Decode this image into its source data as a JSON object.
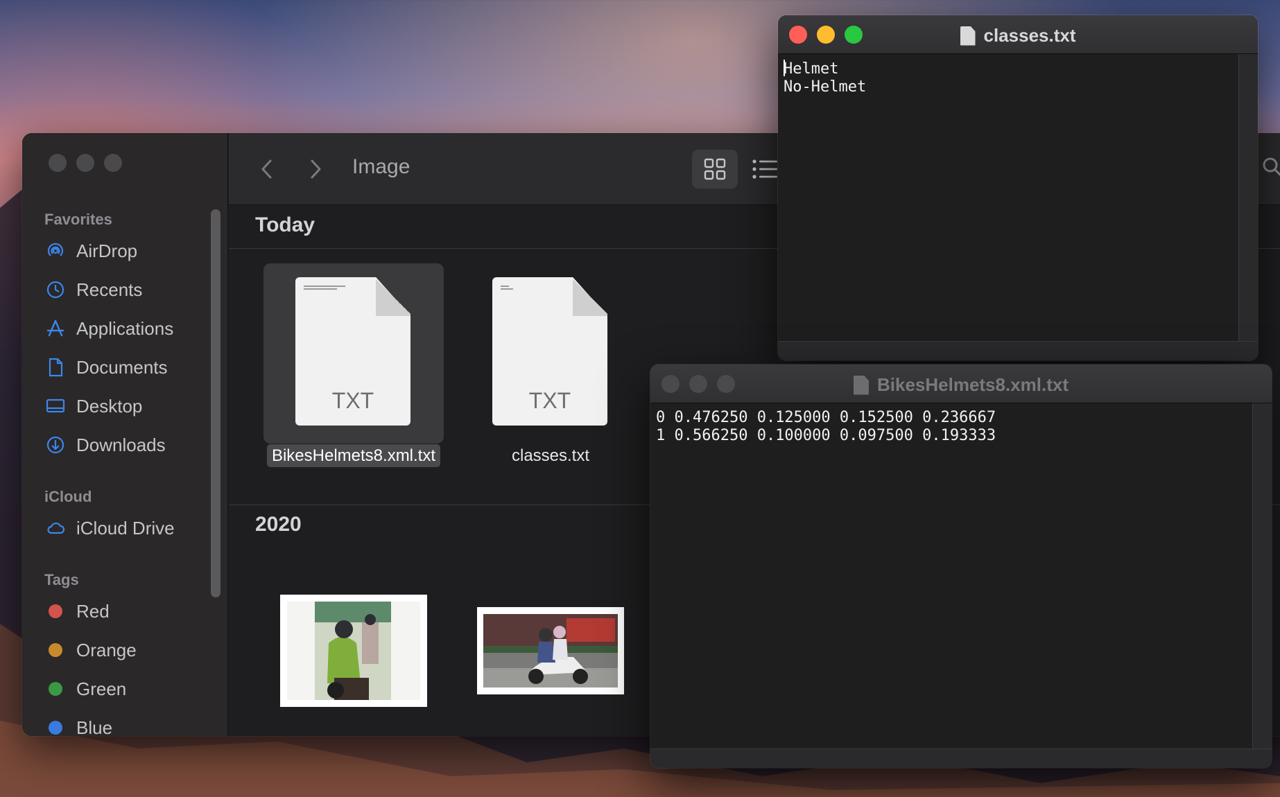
{
  "finder": {
    "folder_title": "Image",
    "sidebar": {
      "favorites_header": "Favorites",
      "favorites": [
        {
          "label": "AirDrop",
          "icon": "airdrop-icon"
        },
        {
          "label": "Recents",
          "icon": "clock-icon"
        },
        {
          "label": "Applications",
          "icon": "applications-icon"
        },
        {
          "label": "Documents",
          "icon": "document-icon"
        },
        {
          "label": "Desktop",
          "icon": "desktop-icon"
        },
        {
          "label": "Downloads",
          "icon": "download-icon"
        }
      ],
      "icloud_header": "iCloud",
      "icloud": [
        {
          "label": "iCloud Drive",
          "icon": "cloud-icon"
        }
      ],
      "tags_header": "Tags",
      "tags": [
        {
          "label": "Red",
          "color": "#d5534d"
        },
        {
          "label": "Orange",
          "color": "#c88a2e"
        },
        {
          "label": "Green",
          "color": "#3a9a43"
        },
        {
          "label": "Blue",
          "color": "#3a7be0"
        }
      ]
    },
    "groups": [
      {
        "title": "Today",
        "files": [
          {
            "name": "BikesHelmets8.xml.txt",
            "kind": "TXT",
            "selected": true
          },
          {
            "name": "classes.txt",
            "kind": "TXT",
            "selected": false
          }
        ]
      },
      {
        "title": "2020",
        "files": [
          {
            "name": "",
            "kind": "image-thumbnail"
          },
          {
            "name": "",
            "kind": "image-thumbnail"
          }
        ]
      }
    ]
  },
  "windows": {
    "classes": {
      "title": "classes.txt",
      "lines": [
        "Helmet",
        "No-Helmet"
      ]
    },
    "bikes": {
      "title": "BikesHelmets8.xml.txt",
      "lines": [
        "0 0.476250 0.125000 0.152500 0.236667",
        "1 0.566250 0.100000 0.097500 0.193333"
      ]
    }
  }
}
